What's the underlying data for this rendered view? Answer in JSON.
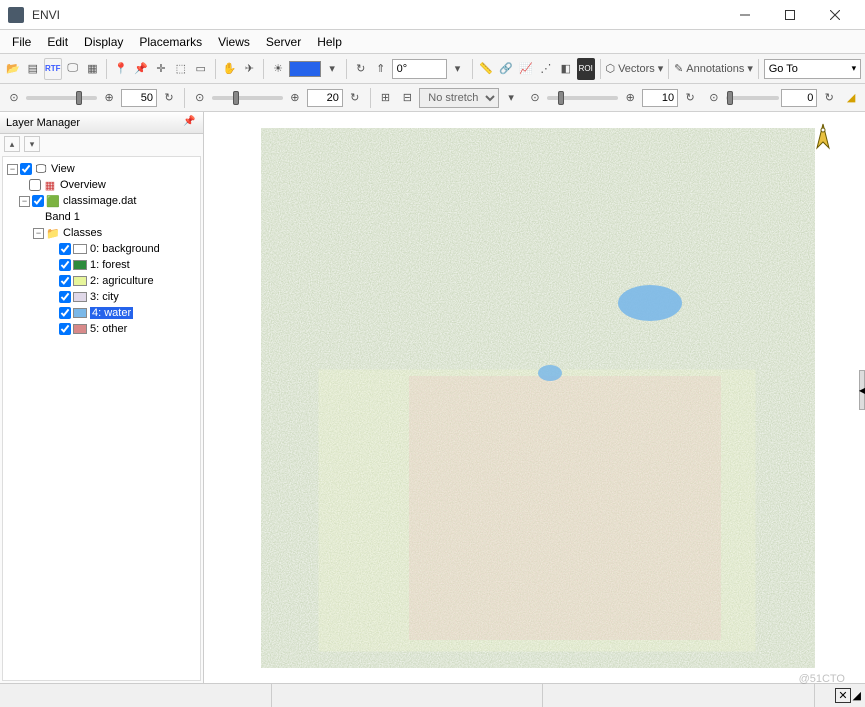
{
  "titlebar": {
    "title": "ENVI"
  },
  "menu": {
    "file": "File",
    "edit": "Edit",
    "display": "Display",
    "placemarks": "Placemarks",
    "views": "Views",
    "server": "Server",
    "help": "Help"
  },
  "toolbar1": {
    "rtf": "RTF",
    "rotation": "0°",
    "vectors": "Vectors",
    "annotations": "Annotations",
    "goto": "Go To"
  },
  "toolbar2": {
    "zoom1": "50",
    "zoom2": "20",
    "stretch": "No stretch",
    "val3": "10",
    "val4": "0"
  },
  "panel": {
    "title": "Layer Manager"
  },
  "tree": {
    "view": "View",
    "overview": "Overview",
    "file": "classimage.dat",
    "band": "Band 1",
    "classes_node": "Classes",
    "classes": [
      {
        "idx": "0:",
        "name": "background",
        "color": "#ffffff"
      },
      {
        "idx": "1:",
        "name": "forest",
        "color": "#2e8b3d"
      },
      {
        "idx": "2:",
        "name": "agriculture",
        "color": "#e7f59b"
      },
      {
        "idx": "3:",
        "name": "city",
        "color": "#e0d8e8"
      },
      {
        "idx": "4:",
        "name": "water",
        "color": "#7bb8e8"
      },
      {
        "idx": "5:",
        "name": "other",
        "color": "#d88a8a"
      }
    ]
  },
  "watermark": "@51CTO"
}
